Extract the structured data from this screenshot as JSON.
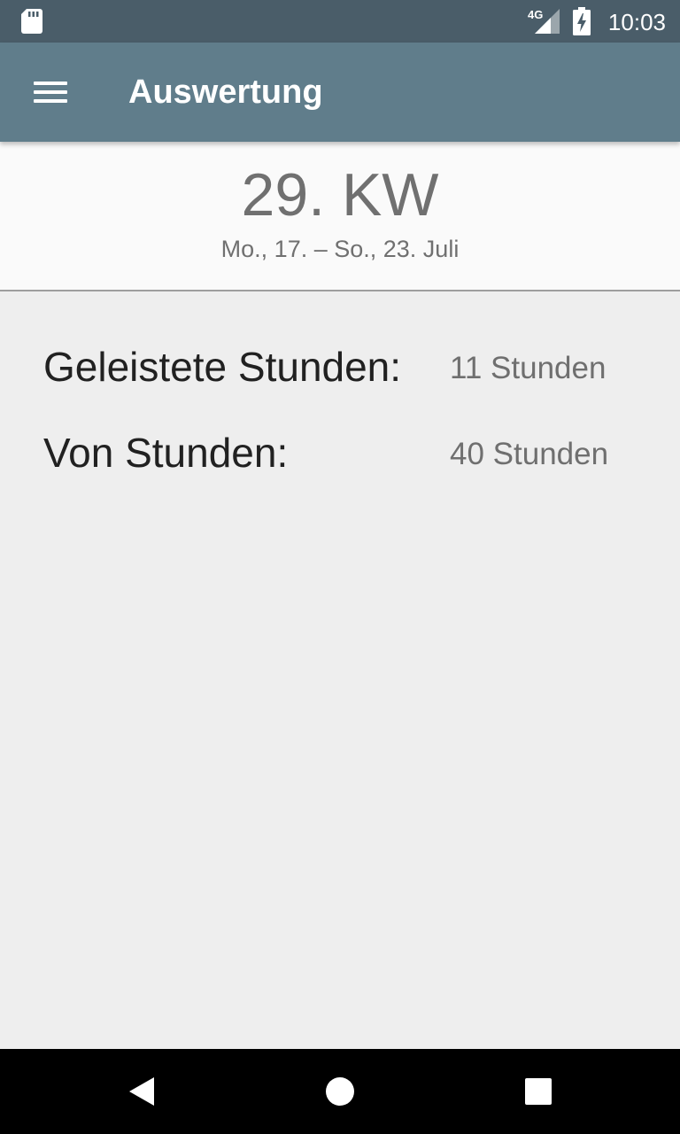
{
  "status_bar": {
    "time": "10:03",
    "network": "4G",
    "icons": [
      "sd-card-icon",
      "signal-4g-icon",
      "battery-charging-icon"
    ]
  },
  "app_bar": {
    "title": "Auswertung",
    "menu_icon": "hamburger-menu-icon"
  },
  "week": {
    "number": "29. KW",
    "range": "Mo., 17. – So., 23. Juli"
  },
  "stats": [
    {
      "label": "Geleistete Stunden:",
      "value": "11 Stunden"
    },
    {
      "label": "Von Stunden:",
      "value": "40 Stunden"
    }
  ],
  "nav_bar": {
    "icons": [
      "back-icon",
      "home-icon",
      "recents-icon"
    ]
  },
  "colors": {
    "status_bar": "#4a5d69",
    "app_bar": "#607d8b",
    "header_bg": "#fafafa",
    "content_bg": "#eeeeee",
    "nav_bar": "#000000"
  }
}
